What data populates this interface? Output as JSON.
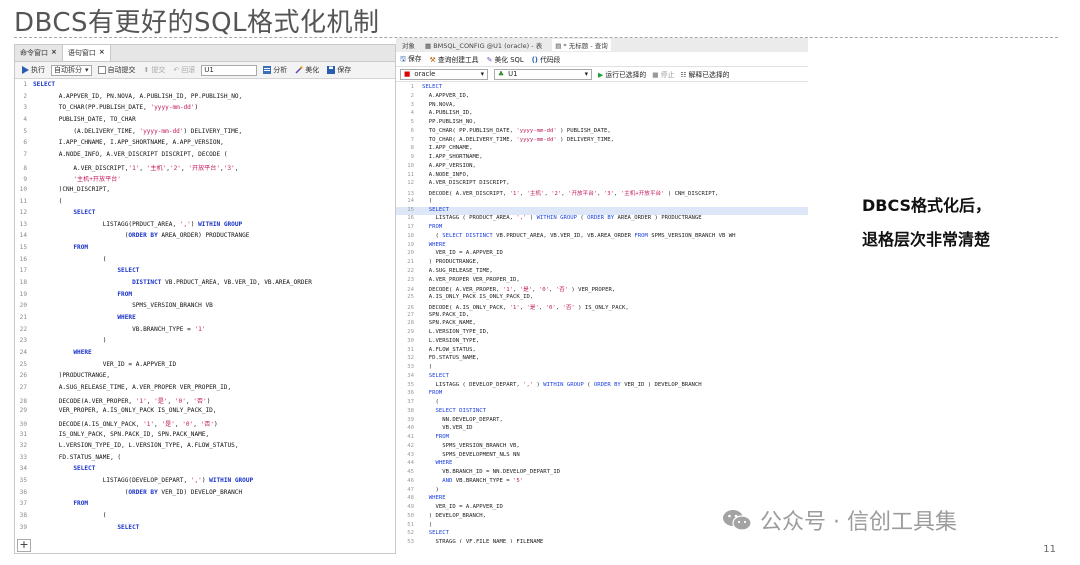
{
  "slide": {
    "title": "DBCS有更好的SQL格式化机制",
    "caption_line1": "DBCS格式化后，",
    "caption_line2": "退格层次非常清楚",
    "watermark": "公众号 · 信创工具集",
    "page_number": "11"
  },
  "left_editor": {
    "tabs": [
      {
        "label": "命令窗口",
        "close": "×"
      },
      {
        "label": "语句窗口",
        "close": "×"
      }
    ],
    "toolbar": {
      "execute": "执行",
      "split_mode": "自动拆分",
      "auto_commit": "自动提交",
      "commit": "提交",
      "rollback": "回滚",
      "schema": "U1",
      "analyze": "分析",
      "beautify": "美化",
      "save": "保存"
    },
    "add_tab": "+",
    "lines": [
      {
        "n": "1",
        "t": "SELECT"
      },
      {
        "n": "2",
        "t": "       A.APPVER_ID, PN.NOVA, A.PUBLISH_ID, PP.PUBLISH_NO,"
      },
      {
        "n": "3",
        "t": "       TO_CHAR(PP.PUBLISH_DATE, 'yyyy-mm-dd')"
      },
      {
        "n": "4",
        "t": "       PUBLISH_DATE, TO_CHAR"
      },
      {
        "n": "5",
        "t": "           (A.DELIVERY_TIME, 'yyyy-mm-dd') DELIVERY_TIME,"
      },
      {
        "n": "6",
        "t": "       I.APP_CHNAME, I.APP_SHORTNAME, A.APP_VERSION,"
      },
      {
        "n": "7",
        "t": "       A.NODE_INFO, A.VER_DISCRIPT DISCRIPT, DECODE ("
      },
      {
        "n": "8",
        "t": "           A.VER_DISCRIPT,'1', '主机','2', '开放平台','3',"
      },
      {
        "n": "9",
        "t": "           '主机+开放平台'"
      },
      {
        "n": "10",
        "t": "       )CNH_DISCRIPT,"
      },
      {
        "n": "11",
        "t": "       ("
      },
      {
        "n": "12",
        "t": "           SELECT"
      },
      {
        "n": "13",
        "t": "                   LISTAGG(PRDUCT_AREA, ',') WITHIN GROUP"
      },
      {
        "n": "14",
        "t": "                         (ORDER BY AREA_ORDER) PRODUCTRANGE"
      },
      {
        "n": "15",
        "t": "           FROM"
      },
      {
        "n": "16",
        "t": "                   ("
      },
      {
        "n": "17",
        "t": "                       SELECT"
      },
      {
        "n": "18",
        "t": "                           DISTINCT VB.PRDUCT_AREA, VB.VER_ID, VB.AREA_ORDER"
      },
      {
        "n": "19",
        "t": "                       FROM"
      },
      {
        "n": "20",
        "t": "                           SPMS_VERSION_BRANCH VB"
      },
      {
        "n": "21",
        "t": "                       WHERE"
      },
      {
        "n": "22",
        "t": "                           VB.BRANCH_TYPE = '1'"
      },
      {
        "n": "23",
        "t": "                   )"
      },
      {
        "n": "24",
        "t": "           WHERE"
      },
      {
        "n": "25",
        "t": "                   VER_ID = A.APPVER_ID"
      },
      {
        "n": "26",
        "t": "       )PRODUCTRANGE,"
      },
      {
        "n": "27",
        "t": "       A.SUG_RELEASE_TIME, A.VER_PROPER VER_PROPER_ID,"
      },
      {
        "n": "28",
        "t": "       DECODE(A.VER_PROPER, '1', '是', '0', '否')"
      },
      {
        "n": "29",
        "t": "       VER_PROPER, A.IS_ONLY_PACK IS_ONLY_PACK_ID,"
      },
      {
        "n": "30",
        "t": "       DECODE(A.IS_ONLY_PACK, '1', '是', '0', '否')"
      },
      {
        "n": "31",
        "t": "       IS_ONLY_PACK, SPN.PACK_ID, SPN.PACK_NAME,"
      },
      {
        "n": "32",
        "t": "       L.VERSION_TYPE_ID, L.VERSION_TYPE, A.FLOW_STATUS,"
      },
      {
        "n": "33",
        "t": "       FD.STATUS_NAME, ("
      },
      {
        "n": "34",
        "t": "           SELECT"
      },
      {
        "n": "35",
        "t": "                   LISTAGG(DEVELOP_DEPART, ',') WITHIN GROUP"
      },
      {
        "n": "36",
        "t": "                         (ORDER BY VER_ID) DEVELOP_BRANCH"
      },
      {
        "n": "37",
        "t": "           FROM"
      },
      {
        "n": "38",
        "t": "                   ("
      },
      {
        "n": "39",
        "t": "                       SELECT"
      }
    ]
  },
  "right_editor": {
    "top_tabs": [
      "对象",
      "BMSQL_CONFIG @U1 (oracle) - 表",
      "* 无标题 - 查询"
    ],
    "toolbar": {
      "save": "保存",
      "query_builder": "查询创建工具",
      "beautify": "美化 SQL",
      "snippet": "代码段"
    },
    "connection": "oracle",
    "schema": "U1",
    "run_selected": "运行已选择的",
    "stop": "停止",
    "explain_selected": "解释已选择的",
    "lines": [
      {
        "n": "1",
        "t": "SELECT"
      },
      {
        "n": "2",
        "t": "  A.APPVER_ID,"
      },
      {
        "n": "3",
        "t": "  PN.NOVA,"
      },
      {
        "n": "4",
        "t": "  A.PUBLISH_ID,"
      },
      {
        "n": "5",
        "t": "  PP.PUBLISH_NO,"
      },
      {
        "n": "6",
        "t": "  TO_CHAR( PP.PUBLISH_DATE, 'yyyy-mm-dd' ) PUBLISH_DATE,"
      },
      {
        "n": "7",
        "t": "  TO_CHAR( A.DELIVERY_TIME, 'yyyy-mm-dd' ) DELIVERY_TIME,"
      },
      {
        "n": "8",
        "t": "  I.APP_CHNAME,"
      },
      {
        "n": "9",
        "t": "  I.APP_SHORTNAME,"
      },
      {
        "n": "10",
        "t": "  A.APP_VERSION,"
      },
      {
        "n": "11",
        "t": "  A.NODE_INFO,"
      },
      {
        "n": "12",
        "t": "  A.VER_DISCRIPT DISCRIPT,"
      },
      {
        "n": "13",
        "t": "  DECODE( A.VER_DISCRIPT, '1', '主机', '2', '开放平台', '3', '主机+开放平台' ) CNH_DISCRIPT,"
      },
      {
        "n": "14",
        "t": "  ("
      },
      {
        "n": "15",
        "t": "  SELECT"
      },
      {
        "n": "16",
        "t": "    LISTAGG ( PRODUCT_AREA, ',' ) WITHIN GROUP ( ORDER BY AREA_ORDER ) PRODUCTRANGE"
      },
      {
        "n": "17",
        "t": "  FROM"
      },
      {
        "n": "18",
        "t": "    ( SELECT DISTINCT VB.PRDUCT_AREA, VB.VER_ID, VB.AREA_ORDER FROM SPMS_VERSION_BRANCH VB WH"
      },
      {
        "n": "19",
        "t": "  WHERE"
      },
      {
        "n": "20",
        "t": "    VER_ID = A.APPVER_ID"
      },
      {
        "n": "21",
        "t": "  ) PRODUCTRANGE,"
      },
      {
        "n": "22",
        "t": "  A.SUG_RELEASE_TIME,"
      },
      {
        "n": "23",
        "t": "  A.VER_PROPER VER_PROPER_ID,"
      },
      {
        "n": "24",
        "t": "  DECODE( A.VER_PROPER, '1', '是', '0', '否' ) VER_PROPER,"
      },
      {
        "n": "25",
        "t": "  A.IS_ONLY_PACK IS_ONLY_PACK_ID,"
      },
      {
        "n": "26",
        "t": "  DECODE( A.IS_ONLY_PACK, '1', '是', '0', '否' ) IS_ONLY_PACK,"
      },
      {
        "n": "27",
        "t": "  SPN.PACK_ID,"
      },
      {
        "n": "28",
        "t": "  SPN.PACK_NAME,"
      },
      {
        "n": "29",
        "t": "  L.VERSION_TYPE_ID,"
      },
      {
        "n": "30",
        "t": "  L.VERSION_TYPE,"
      },
      {
        "n": "31",
        "t": "  A.FLOW_STATUS,"
      },
      {
        "n": "32",
        "t": "  FD.STATUS_NAME,"
      },
      {
        "n": "33",
        "t": "  ("
      },
      {
        "n": "34",
        "t": "  SELECT"
      },
      {
        "n": "35",
        "t": "    LISTAGG ( DEVELOP_DEPART, ',' ) WITHIN GROUP ( ORDER BY VER_ID ) DEVELOP_BRANCH"
      },
      {
        "n": "36",
        "t": "  FROM"
      },
      {
        "n": "37",
        "t": "    ("
      },
      {
        "n": "38",
        "t": "    SELECT DISTINCT"
      },
      {
        "n": "39",
        "t": "      NN.DEVELOP_DEPART,"
      },
      {
        "n": "40",
        "t": "      VB.VER_ID"
      },
      {
        "n": "41",
        "t": "    FROM"
      },
      {
        "n": "42",
        "t": "      SPMS_VERSION_BRANCH VB,"
      },
      {
        "n": "43",
        "t": "      SPMS_DEVELOPMENT_NLS NN"
      },
      {
        "n": "44",
        "t": "    WHERE"
      },
      {
        "n": "45",
        "t": "      VB.BRANCH_ID = NN.DEVELOP_DEPART_ID"
      },
      {
        "n": "46",
        "t": "      AND VB.BRANCH_TYPE = '5'"
      },
      {
        "n": "47",
        "t": "    )"
      },
      {
        "n": "48",
        "t": "  WHERE"
      },
      {
        "n": "49",
        "t": "    VER_ID = A.APPVER_ID"
      },
      {
        "n": "50",
        "t": "  ) DEVELOP_BRANCH,"
      },
      {
        "n": "51",
        "t": "  ("
      },
      {
        "n": "52",
        "t": "  SELECT"
      },
      {
        "n": "53",
        "t": "    STRAGG ( VF.FILE_NAME ) FILENAME"
      }
    ]
  }
}
